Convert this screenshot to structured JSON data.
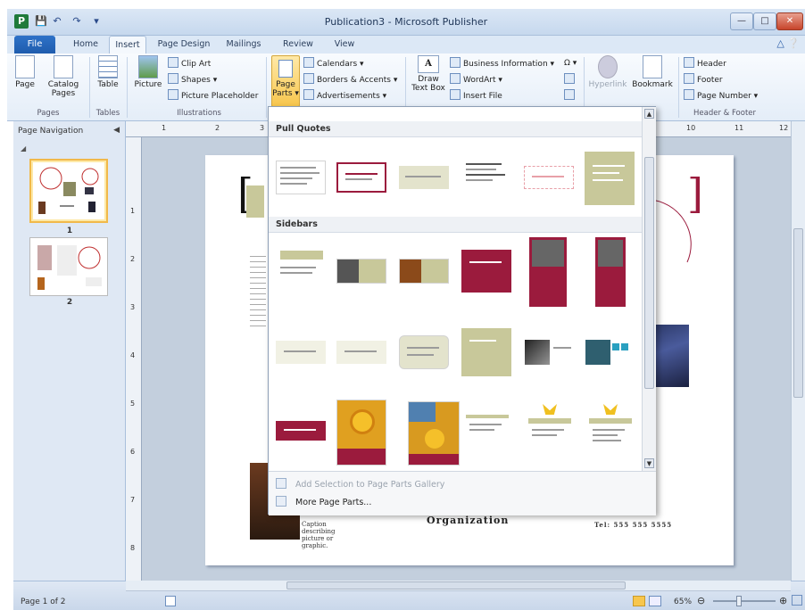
{
  "window": {
    "title": "Publication3 - Microsoft Publisher",
    "app_icon": "P",
    "qat_icons": [
      "save-icon",
      "undo-icon",
      "redo-icon",
      "customize-icon"
    ]
  },
  "tabs": {
    "file": "File",
    "items": [
      "Home",
      "Insert",
      "Page Design",
      "Mailings",
      "Review",
      "View"
    ],
    "active": "Insert"
  },
  "ribbon": {
    "pages": {
      "page": "Page",
      "catalog": "Catalog",
      "catalog2": "Pages",
      "label": "Pages"
    },
    "tables": {
      "table": "Table",
      "label": "Tables"
    },
    "illustrations": {
      "picture": "Picture",
      "clip_art": "Clip Art",
      "shapes": "Shapes",
      "picture_placeholder": "Picture Placeholder",
      "label": "Illustrations"
    },
    "building_blocks": {
      "page": "Page",
      "parts": "Parts",
      "calendars": "Calendars",
      "borders": "Borders & Accents",
      "ads": "Advertisements"
    },
    "text": {
      "draw": "Draw",
      "textbox": "Text Box",
      "business": "Business Information",
      "wordart": "WordArt",
      "insert_file": "Insert File"
    },
    "links": {
      "hyperlink": "Hyperlink",
      "bookmark": "Bookmark"
    },
    "header_footer": {
      "header": "Header",
      "footer": "Footer",
      "page_number": "Page Number",
      "label": "Header & Footer"
    }
  },
  "nav": {
    "title": "Page Navigation",
    "pages": [
      "1",
      "2"
    ]
  },
  "gallery": {
    "section1": "Pull Quotes",
    "section2": "Sidebars",
    "add_selection": "Add Selection to Page Parts Gallery",
    "more": "More Page Parts..."
  },
  "page_content": {
    "organization": "Organization",
    "caption": "Caption describing picture or graphic.",
    "tel": "Tel: 555 555 5555"
  },
  "status": {
    "page": "Page 1 of 2",
    "zoom": "65%"
  },
  "rulers": {
    "h": [
      "1",
      "2",
      "3",
      "10",
      "11",
      "12"
    ],
    "v": [
      "1",
      "2",
      "3",
      "4",
      "5",
      "6",
      "7",
      "8"
    ]
  },
  "colors": {
    "accent": "#9b1b3d",
    "sidebar_tan": "#c8c89a",
    "ribbon_blue": "#dce8f6"
  }
}
